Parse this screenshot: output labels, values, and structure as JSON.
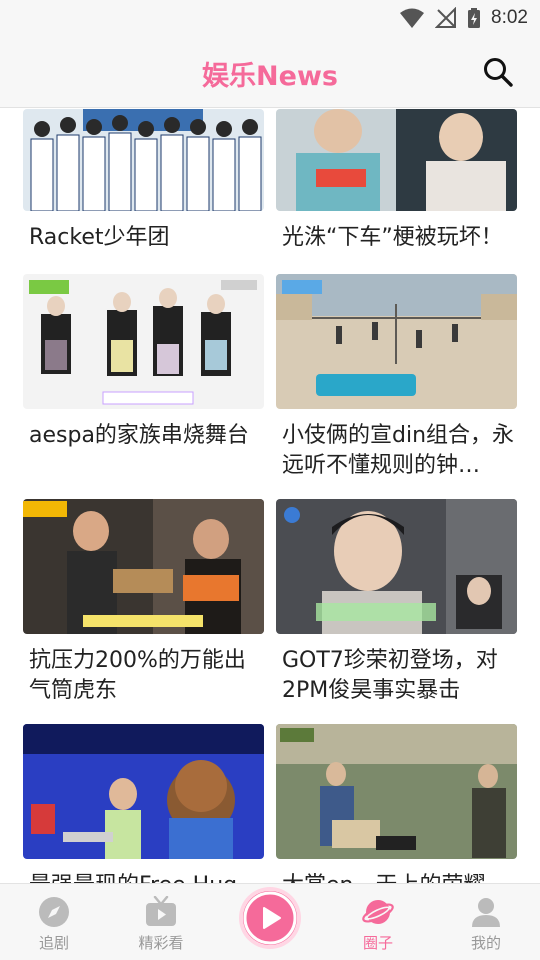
{
  "status": {
    "time": "8:02"
  },
  "header": {
    "title": "娱乐News",
    "search_icon": "search-icon"
  },
  "feed": {
    "cards": [
      {
        "title": "Racket少年团",
        "thumb_colors": [
          "#5a8fc4",
          "#dfe8ef",
          "#1c3a6b"
        ]
      },
      {
        "title": "光洙“下车”梗被玩坏！",
        "thumb_colors": [
          "#6a7b86",
          "#c8d2d6",
          "#2e3a42"
        ]
      },
      {
        "title": "aespa的家族串烧舞台",
        "thumb_colors": [
          "#f3f3f3",
          "#e7e1ea",
          "#222222"
        ]
      },
      {
        "title": "小伎俩的宣din组合，永远听不懂规则的钟…",
        "thumb_colors": [
          "#a9b9c4",
          "#d8cbb5",
          "#5d5a55"
        ]
      },
      {
        "title": "抗压力200%的万能出气筒虎东",
        "thumb_colors": [
          "#3a3530",
          "#b58c58",
          "#1e1b18"
        ]
      },
      {
        "title": "GOT7珍荣初登场，对2PM俊昊事实暴击",
        "thumb_colors": [
          "#4b4d52",
          "#c9c5c0",
          "#1c1c1e"
        ]
      },
      {
        "title": "最强最现的Free Hug",
        "thumb_colors": [
          "#2a3ec2",
          "#6b4fd6",
          "#101a5c"
        ]
      },
      {
        "title": "大赏en，天上的荣耀",
        "thumb_colors": [
          "#7c8a6b",
          "#b8b49a",
          "#3e3f35"
        ]
      }
    ]
  },
  "tabbar": {
    "tabs": [
      {
        "label": "追剧",
        "icon": "compass-icon"
      },
      {
        "label": "精彩看",
        "icon": "tv-icon"
      },
      {
        "label": "",
        "icon": "play-icon"
      },
      {
        "label": "圈子",
        "icon": "planet-icon"
      },
      {
        "label": "我的",
        "icon": "profile-icon"
      }
    ]
  },
  "colors": {
    "accent": "#f56a9a",
    "inactive": "#bbbbbb"
  }
}
